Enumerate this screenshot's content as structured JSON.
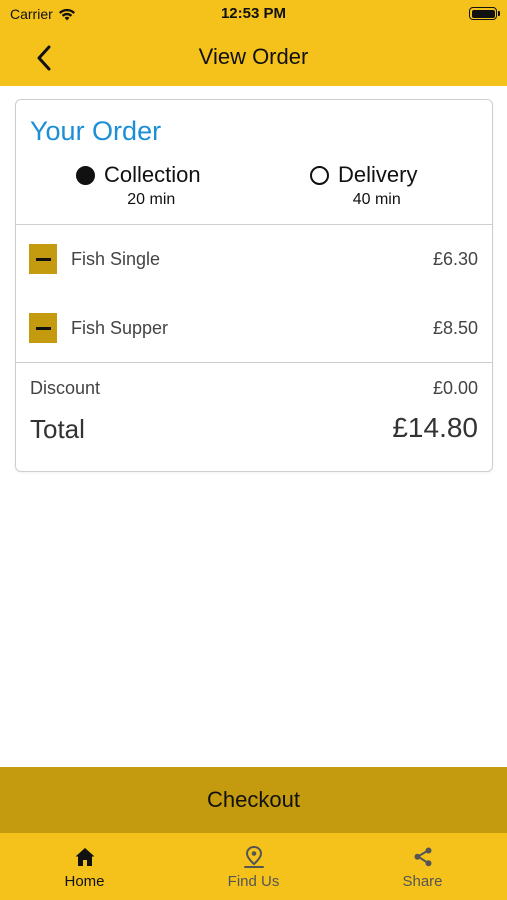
{
  "status_bar": {
    "carrier": "Carrier",
    "time": "12:53 PM"
  },
  "nav": {
    "title": "View Order"
  },
  "order": {
    "title": "Your Order",
    "options": [
      {
        "label": "Collection",
        "time": "20 min",
        "selected": true
      },
      {
        "label": "Delivery",
        "time": "40 min",
        "selected": false
      }
    ],
    "items": [
      {
        "name": "Fish Single",
        "price": "£6.30"
      },
      {
        "name": "Fish Supper",
        "price": "£8.50"
      }
    ],
    "discount_label": "Discount",
    "discount_value": "£0.00",
    "total_label": "Total",
    "total_value": "£14.80"
  },
  "checkout": {
    "label": "Checkout"
  },
  "tabs": [
    {
      "label": "Home",
      "icon": "home-icon",
      "active": true
    },
    {
      "label": "Find Us",
      "icon": "location-pin-icon",
      "active": false
    },
    {
      "label": "Share",
      "icon": "share-icon",
      "active": false
    }
  ],
  "colors": {
    "brand_yellow": "#f5c21b",
    "accent_gold": "#c49a0e",
    "title_blue": "#1a8fd6"
  }
}
